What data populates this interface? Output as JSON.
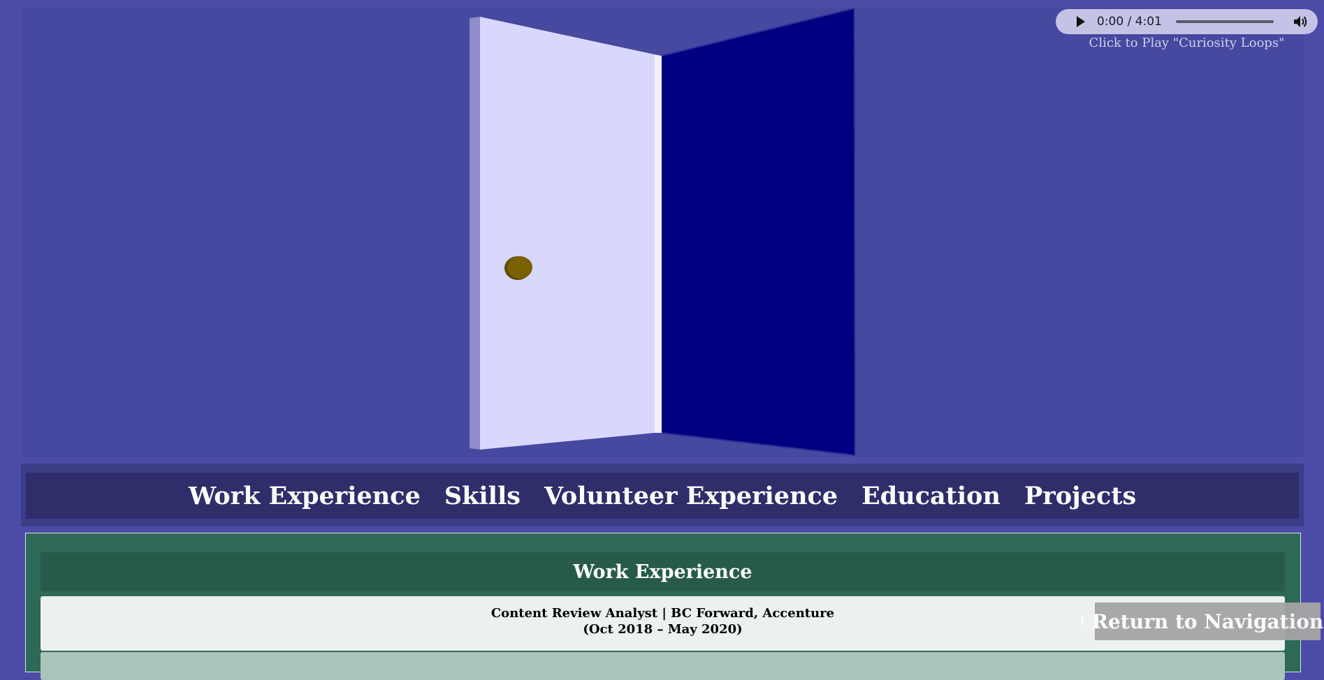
{
  "audio": {
    "time": "0:00 / 4:01",
    "caption": "Click to Play \"Curiosity Loops\"",
    "progress_fraction": 0,
    "play_icon": "play-icon",
    "volume_icon": "volume-icon"
  },
  "hero": {
    "illustration": "open-door",
    "colors": {
      "background": "#47489f",
      "door_face": "#d8d7fe",
      "door_edge": "#8e8cc9",
      "doorway": "#000080",
      "knob": "#7a6000"
    }
  },
  "nav": {
    "items": [
      {
        "label": "Work Experience"
      },
      {
        "label": "Skills"
      },
      {
        "label": "Volunteer Experience"
      },
      {
        "label": "Education"
      },
      {
        "label": "Projects"
      }
    ]
  },
  "work_experience": {
    "heading": "Work Experience",
    "jobs": [
      {
        "title": "Content Review Analyst | BC Forward, Accenture",
        "dates": "(Oct 2018 – May 2020)"
      }
    ]
  },
  "return_button": {
    "arrow_left": "↑",
    "label": "Return to Navigation",
    "arrow_right": "↑"
  },
  "colors": {
    "page_bg": "#4c4ba7",
    "nav_bg": "#2f2e6a",
    "section_bg": "#2e6958",
    "section_header_bg": "#275a4a",
    "card_bg": "#eaf1ee"
  }
}
